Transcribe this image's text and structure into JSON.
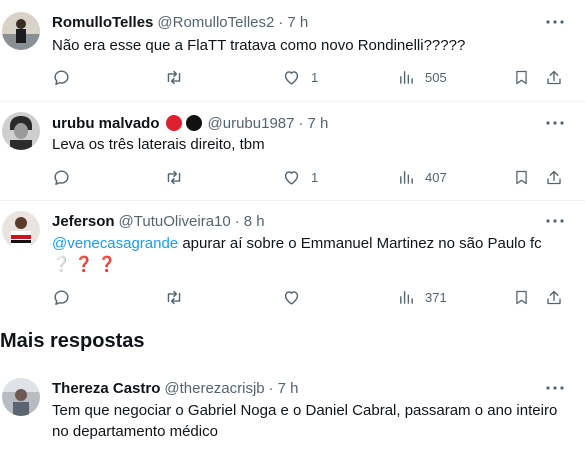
{
  "tweets": [
    {
      "name": "RomulloTelles",
      "handle": "@RomulloTelles2",
      "sep": "·",
      "time": "7 h",
      "text": "Não era esse que a FlaTT tratava como novo Rondinelli?????",
      "likes": "1",
      "views": "505"
    },
    {
      "name": "urubu malvado",
      "handle": "@urubu1987",
      "sep": "·",
      "time": "7 h",
      "text": "Leva os três laterais direito, tbm",
      "likes": "1",
      "views": "407",
      "badge_colors": [
        "#e0202e",
        "#111111"
      ]
    },
    {
      "name": "Jeferson",
      "handle": "@TutuOliveira10",
      "sep": "·",
      "time": "8 h",
      "mention": "@venecasagrande",
      "text": " apurar aí sobre o Emmanuel Martinez no são Paulo fc",
      "q1": "❔",
      "q2": "❓",
      "q3": "❓",
      "views": "371"
    },
    {
      "name": "Thereza Castro",
      "handle": "@therezacrisjb",
      "sep": "·",
      "time": "7 h",
      "text": "Tem que negociar o Gabriel Noga e o Daniel Cabral, passaram o ano inteiro no departamento médico"
    }
  ],
  "section": {
    "title": "Mais respostas"
  },
  "colors": {
    "text": "#0f1419",
    "muted": "#536471",
    "link": "#1d9bf0",
    "divider": "#eff3f4"
  },
  "icons": [
    "more-icon",
    "reply-icon",
    "retweet-icon",
    "like-icon",
    "views-icon",
    "bookmark-icon",
    "share-icon"
  ]
}
